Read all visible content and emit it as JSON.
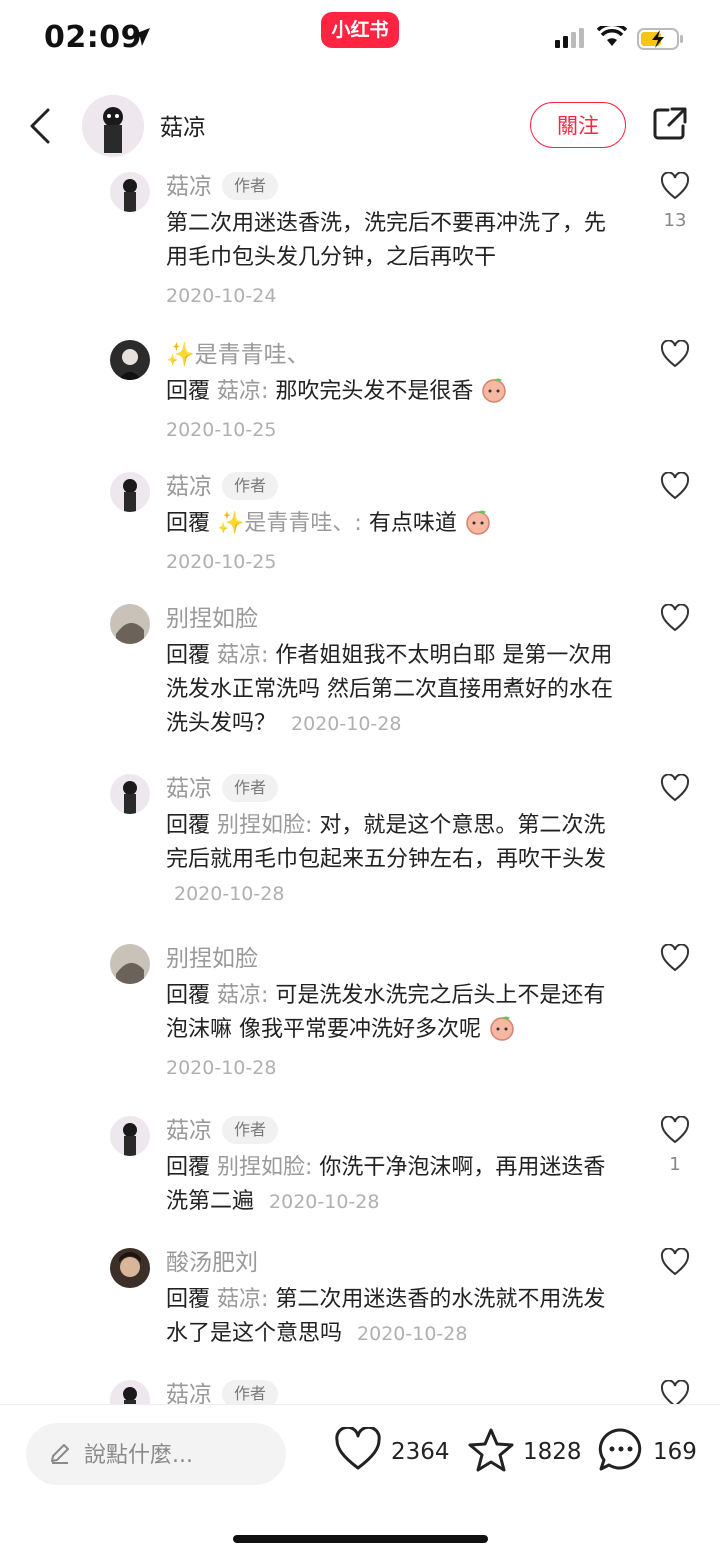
{
  "status_bar": {
    "time": "02:09",
    "brand": "小红书"
  },
  "header": {
    "nickname": "菇凉",
    "follow_label": "關注"
  },
  "comments": [
    {
      "name": "菇凉",
      "tag": "作者",
      "text": "第二次用迷迭香洗，洗完后不要再冲洗了，先用毛巾包头发几分钟，之后再吹干",
      "date": "2020-10-24",
      "likes": "13"
    },
    {
      "name": "✨是青青哇、",
      "reply": "回覆",
      "mention": "菇凉:",
      "text": " 那吹完头发不是很香",
      "date": "2020-10-25"
    },
    {
      "name": "菇凉",
      "tag": "作者",
      "reply": "回覆",
      "mention": "✨是青青哇、:",
      "text": " 有点味道",
      "date": "2020-10-25"
    },
    {
      "name": "别捏如脸",
      "reply": "回覆",
      "mention": "菇凉:",
      "text": " 作者姐姐我不太明白耶 是第一次用洗发水正常洗吗 然后第二次直接用煮好的水在洗头发吗？",
      "date": "2020-10-28"
    },
    {
      "name": "菇凉",
      "tag": "作者",
      "reply": "回覆",
      "mention": "别捏如脸:",
      "text": " 对，就是这个意思。第二次洗完后就用毛巾包起来五分钟左右，再吹干头发",
      "date": "2020-10-28"
    },
    {
      "name": "别捏如脸",
      "reply": "回覆",
      "mention": "菇凉:",
      "text": " 可是洗发水洗完之后头上不是还有泡沫嘛 像我平常要冲洗好多次呢",
      "date": "2020-10-28"
    },
    {
      "name": "菇凉",
      "tag": "作者",
      "reply": "回覆",
      "mention": "别捏如脸:",
      "text": " 你洗干净泡沫啊，再用迷迭香洗第二遍",
      "date": "2020-10-28",
      "likes": "1"
    },
    {
      "name": "酸汤肥刘",
      "reply": "回覆",
      "mention": "菇凉:",
      "text": " 第二次用迷迭香的水洗就不用洗发水了是这个意思吗",
      "date": "2020-10-28"
    },
    {
      "name": "菇凉",
      "tag": "作者"
    }
  ],
  "bottom_bar": {
    "input_placeholder": "說點什麼...",
    "likes": "2364",
    "collects": "1828",
    "comments": "169"
  },
  "colors": {
    "accent": "#ff2442",
    "muted_text": "#9a9a9a",
    "date_text": "#b0b0b0"
  }
}
